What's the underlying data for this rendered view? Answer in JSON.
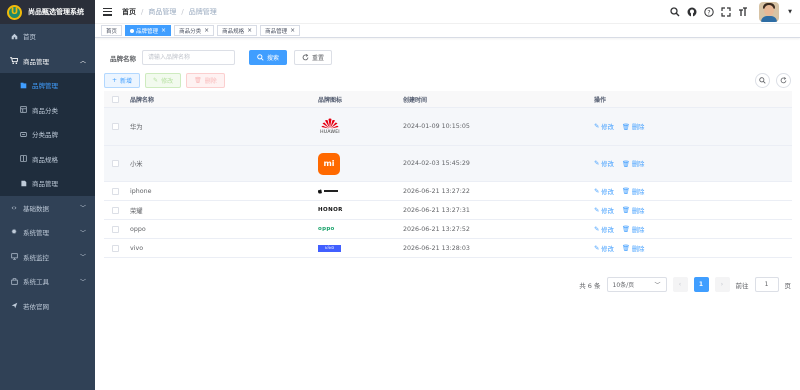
{
  "app": {
    "title": "尚品甄选管理系统",
    "logo_letter": "U"
  },
  "sidebar": {
    "items": [
      {
        "label": "首页",
        "icon": "dashboard-icon"
      },
      {
        "label": "商品管理",
        "icon": "cart-icon",
        "expanded": true,
        "children": [
          {
            "label": "品牌管理",
            "icon": "brand-icon",
            "active": true
          },
          {
            "label": "商品分类",
            "icon": "category-icon"
          },
          {
            "label": "分类品牌",
            "icon": "link-icon"
          },
          {
            "label": "商品规格",
            "icon": "spec-icon"
          },
          {
            "label": "商品管理",
            "icon": "goods-icon"
          }
        ]
      },
      {
        "label": "基础数据",
        "icon": "code-icon"
      },
      {
        "label": "系统管理",
        "icon": "gear-icon"
      },
      {
        "label": "系统监控",
        "icon": "monitor-icon"
      },
      {
        "label": "系统工具",
        "icon": "tool-icon"
      },
      {
        "label": "若依官网",
        "icon": "send-icon"
      }
    ]
  },
  "breadcrumb": [
    "首页",
    "商品管理",
    "品牌管理"
  ],
  "tags": [
    {
      "label": "首页",
      "active": false,
      "closable": false
    },
    {
      "label": "品牌管理",
      "active": true,
      "closable": true
    },
    {
      "label": "商品分类",
      "active": false,
      "closable": true
    },
    {
      "label": "商品规格",
      "active": false,
      "closable": true
    },
    {
      "label": "商品管理",
      "active": false,
      "closable": true
    }
  ],
  "search": {
    "label": "品牌名称",
    "placeholder": "请输入品牌名称",
    "search_label": "搜索",
    "reset_label": "重置"
  },
  "toolbar": {
    "add_label": "新增",
    "edit_label": "修改",
    "delete_label": "删除"
  },
  "table": {
    "columns": [
      "品牌名称",
      "品牌图标",
      "创建时间",
      "操作"
    ],
    "edit_label": "修改",
    "delete_label": "删除",
    "rows": [
      {
        "name": "华为",
        "logo": "huawei",
        "logo_text": "HUAWEI",
        "created": "2024-01-09 10:15:05"
      },
      {
        "name": "小米",
        "logo": "xiaomi",
        "logo_text": "mi",
        "created": "2024-02-03 15:45:29"
      },
      {
        "name": "iphone",
        "logo": "apple",
        "logo_text": "",
        "created": "2026-06-21 13:27:22"
      },
      {
        "name": "荣耀",
        "logo": "honor",
        "logo_text": "HONOR",
        "created": "2026-06-21 13:27:31"
      },
      {
        "name": "oppo",
        "logo": "oppo",
        "logo_text": "oppo",
        "created": "2026-06-21 13:27:52"
      },
      {
        "name": "vivo",
        "logo": "vivo",
        "logo_text": "vivo",
        "created": "2026-06-21 13:28:03"
      }
    ]
  },
  "pagination": {
    "total_text": "共 6 条",
    "page_size": "10条/页",
    "current_page": "1",
    "goto_label": "前往",
    "goto_value": "1",
    "page_suffix": "页"
  },
  "colors": {
    "primary": "#409eff",
    "sidebar_bg": "#304156",
    "xiaomi": "#ff6900",
    "vivo": "#415fff",
    "oppo": "#1aa36b"
  }
}
